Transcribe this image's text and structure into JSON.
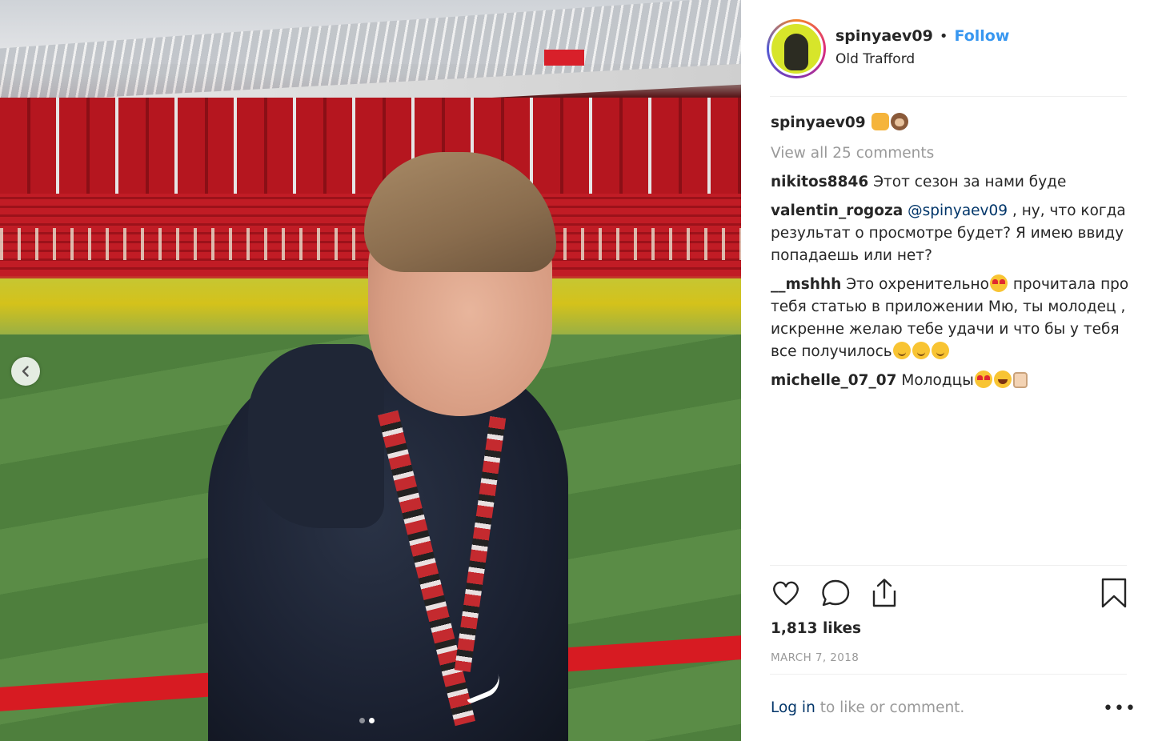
{
  "post": {
    "username": "spinyaev09",
    "follow_separator": "•",
    "follow_label": "Follow",
    "location": "Old Trafford",
    "caption_user": "spinyaev09",
    "view_all_comments": "View all 25 comments",
    "comments": [
      {
        "user": "nikitos8846",
        "text": "Этот сезон за нами буде"
      },
      {
        "user": "valentin_rogoza",
        "mention": "@spinyaev09",
        "text": ", ну, что когда результат о просмотре будет? Я имею ввиду попадаешь или нет?"
      },
      {
        "user": "__mshhh",
        "text_before": "Это охренительно",
        "text_after": "прочитала про тебя статью в приложении Мю, ты молодец , искренне желаю тебе удачи и что бы у тебя все получилось"
      },
      {
        "user": "michelle_07_07",
        "text": "Молодцы"
      }
    ],
    "likes": "1,813 likes",
    "date": "MARCH 7, 2018",
    "login_link": "Log in",
    "login_rest": "to like or comment.",
    "more_label": "•••"
  },
  "carousel": {
    "total": 2,
    "active_index": 1
  },
  "icons": {
    "prev": "chevron-left-icon",
    "like": "heart-icon",
    "comment": "speech-bubble-icon",
    "share": "share-icon",
    "save": "bookmark-icon"
  },
  "colors": {
    "follow": "#3897f0",
    "link": "#003569",
    "muted": "#999999",
    "text": "#262626"
  }
}
